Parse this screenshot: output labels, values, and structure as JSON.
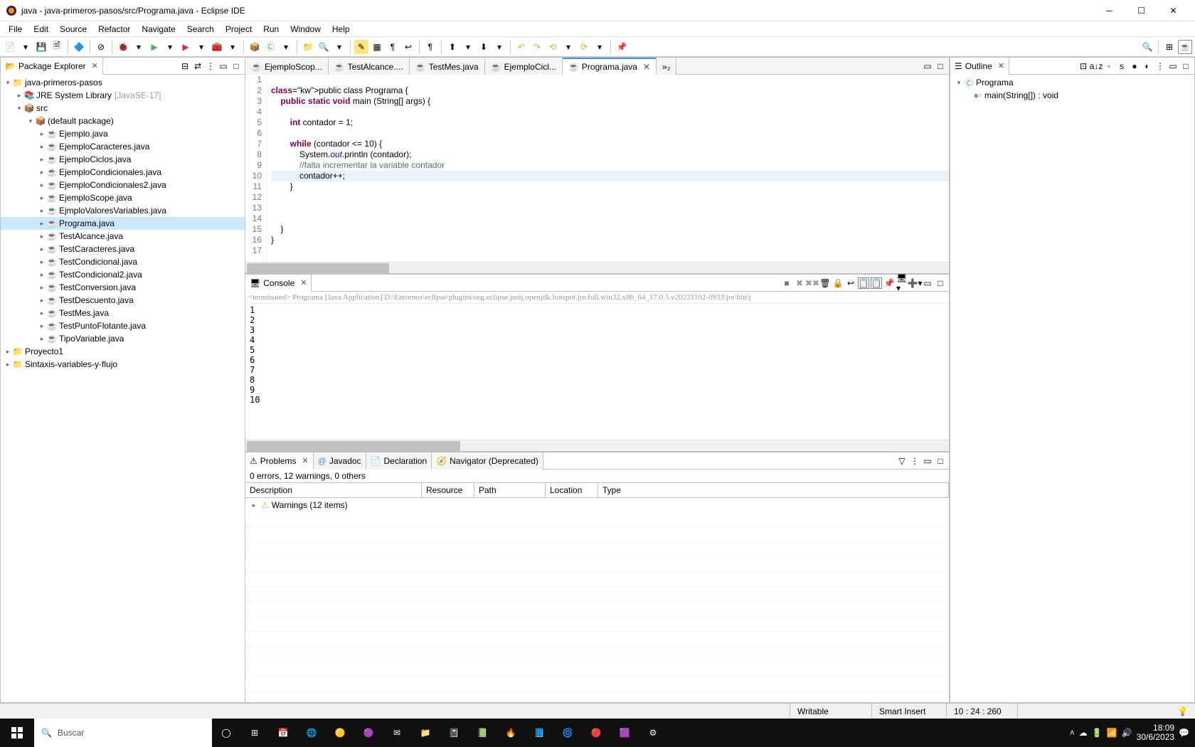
{
  "window": {
    "title": "java - java-primeros-pasos/src/Programa.java - Eclipse IDE"
  },
  "menu": [
    "File",
    "Edit",
    "Source",
    "Refactor",
    "Navigate",
    "Search",
    "Project",
    "Run",
    "Window",
    "Help"
  ],
  "packageExplorer": {
    "title": "Package Explorer",
    "projects": [
      {
        "name": "java-primeros-pasos",
        "jre": {
          "label": "JRE System Library",
          "deco": "[JavaSE-17]"
        },
        "src": "src",
        "pkg": "(default package)",
        "files": [
          "Ejemplo.java",
          "EjemploCaracteres.java",
          "EjemploCiclos.java",
          "EjemploCondicionales.java",
          "EjemploCondicionales2.java",
          "EjemploScope.java",
          "EjmploValoresVariables.java",
          "Programa.java",
          "TestAlcance.java",
          "TestCaracteres.java",
          "TestCondicional.java",
          "TestCondicional2.java",
          "TestConversion.java",
          "TestDescuento.java",
          "TestMes.java",
          "TestPuntoFlotante.java",
          "TipoVariable.java"
        ]
      }
    ],
    "otherProjects": [
      "Proyecto1",
      "Sintaxis-variables-y-flujo"
    ]
  },
  "editorTabs": [
    {
      "label": "EjemploScop...",
      "active": false
    },
    {
      "label": "TestAlcance....",
      "active": false
    },
    {
      "label": "TestMes.java",
      "active": false
    },
    {
      "label": "EjemploCicl...",
      "active": false
    },
    {
      "label": "Programa.java",
      "active": true
    }
  ],
  "overflowTabs": "»₂",
  "code": {
    "lines": [
      {
        "n": 1,
        "t": ""
      },
      {
        "n": 2,
        "t": "public class Programa {",
        "kw": [
          "public",
          "class"
        ]
      },
      {
        "n": 3,
        "t": "    public static void main (String[] args) {",
        "kw": [
          "public",
          "static",
          "void"
        ]
      },
      {
        "n": 4,
        "t": ""
      },
      {
        "n": 5,
        "t": "        int contador = 1;",
        "kw": [
          "int"
        ]
      },
      {
        "n": 6,
        "t": ""
      },
      {
        "n": 7,
        "t": "        while (contador <= 10) {",
        "kw": [
          "while"
        ]
      },
      {
        "n": 8,
        "t": "            System.out.println (contador);"
      },
      {
        "n": 9,
        "t": "            //falta incrementar la variable contador",
        "cmt": true
      },
      {
        "n": 10,
        "t": "            contador++;",
        "hl": true
      },
      {
        "n": 11,
        "t": "        }"
      },
      {
        "n": 12,
        "t": ""
      },
      {
        "n": 13,
        "t": ""
      },
      {
        "n": 14,
        "t": ""
      },
      {
        "n": 15,
        "t": "    }"
      },
      {
        "n": 16,
        "t": "}"
      },
      {
        "n": 17,
        "t": ""
      }
    ]
  },
  "console": {
    "title": "Console",
    "header": "<terminated> Programa [Java Application] D:\\Entornos\\eclipse\\plugins\\org.eclipse.justj.openjdk.hotspot.jre.full.win32.x86_64_17.0.5.v20221102-0933\\jre\\bin\\j",
    "output": [
      "1",
      "2",
      "3",
      "4",
      "5",
      "6",
      "7",
      "8",
      "9",
      "10"
    ]
  },
  "outline": {
    "title": "Outline",
    "class": "Programa",
    "method": "main(String[]) : void"
  },
  "bottomTabs": {
    "problems": "Problems",
    "javadoc": "Javadoc",
    "declaration": "Declaration",
    "navigator": "Navigator (Deprecated)"
  },
  "problems": {
    "summary": "0 errors, 12 warnings, 0 others",
    "cols": [
      "Description",
      "Resource",
      "Path",
      "Location",
      "Type"
    ],
    "warnings": "Warnings (12 items)"
  },
  "status": {
    "writable": "Writable",
    "insert": "Smart Insert",
    "pos": "10 : 24 : 260"
  },
  "taskbar": {
    "search": "Buscar",
    "time": "18:09",
    "date": "30/6/2023"
  }
}
